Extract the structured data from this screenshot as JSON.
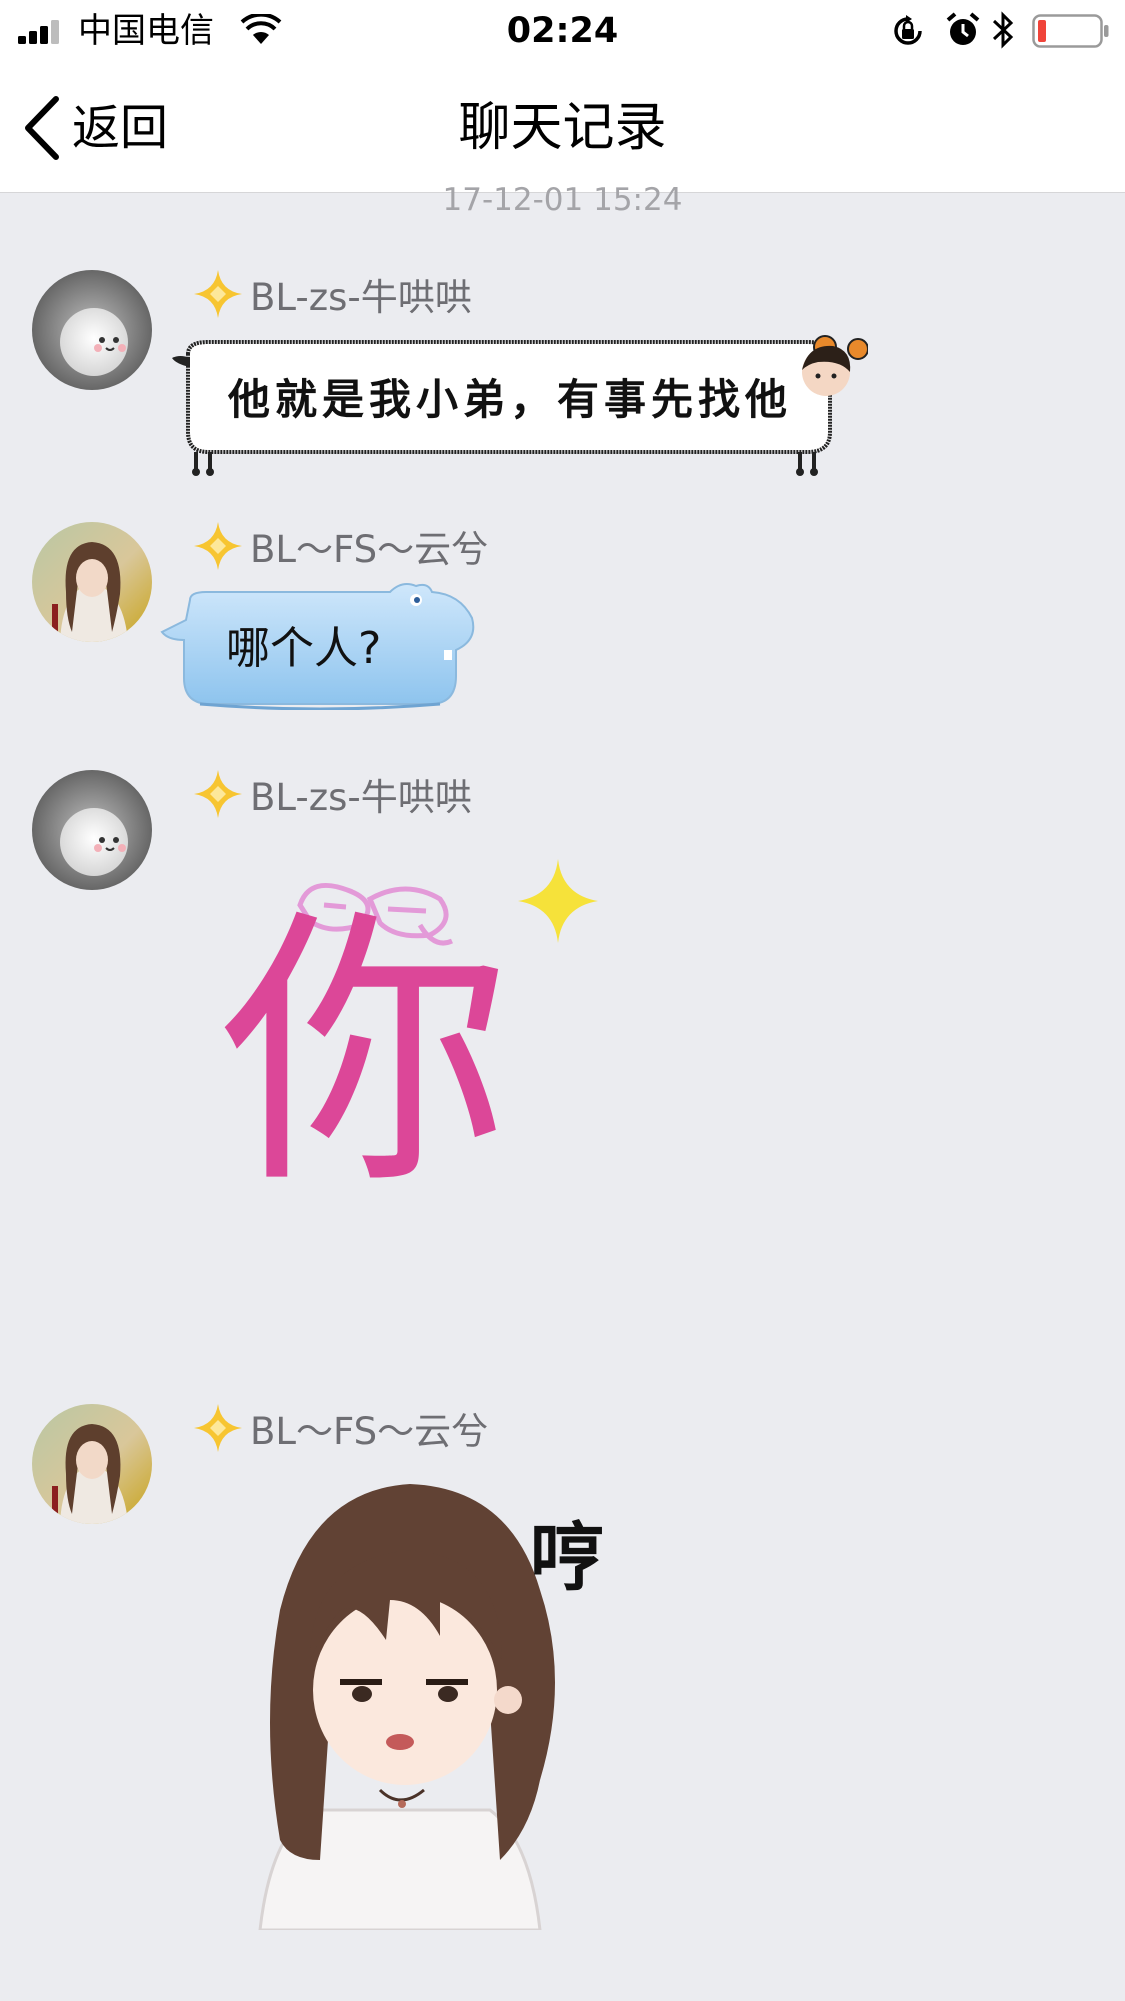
{
  "status_bar": {
    "carrier": "中国电信",
    "time": "02:24",
    "icons": [
      "signal-icon",
      "wifi-icon",
      "orientation-lock-icon",
      "alarm-icon",
      "bluetooth-icon",
      "battery-icon"
    ],
    "battery_color": "#f0443a"
  },
  "nav": {
    "back_label": "返回",
    "title": "聊天记录"
  },
  "timestamp": "17-12-01 15:24",
  "messages": [
    {
      "sender": "BL-zs-牛哄哄",
      "type": "text",
      "text": "他就是我小弟，有事先找他"
    },
    {
      "sender": "BL～FS～云兮",
      "type": "text",
      "text": "哪个人?"
    },
    {
      "sender": "BL-zs-牛哄哄",
      "type": "sticker",
      "sticker_text": "你"
    },
    {
      "sender": "BL～FS～云兮",
      "type": "sticker",
      "sticker_text": "哼"
    }
  ],
  "colors": {
    "background": "#ebecf0",
    "badge": "#f7c531",
    "sticker_pink": "#dc4798",
    "bubble_blue": "#a9d4f4"
  }
}
